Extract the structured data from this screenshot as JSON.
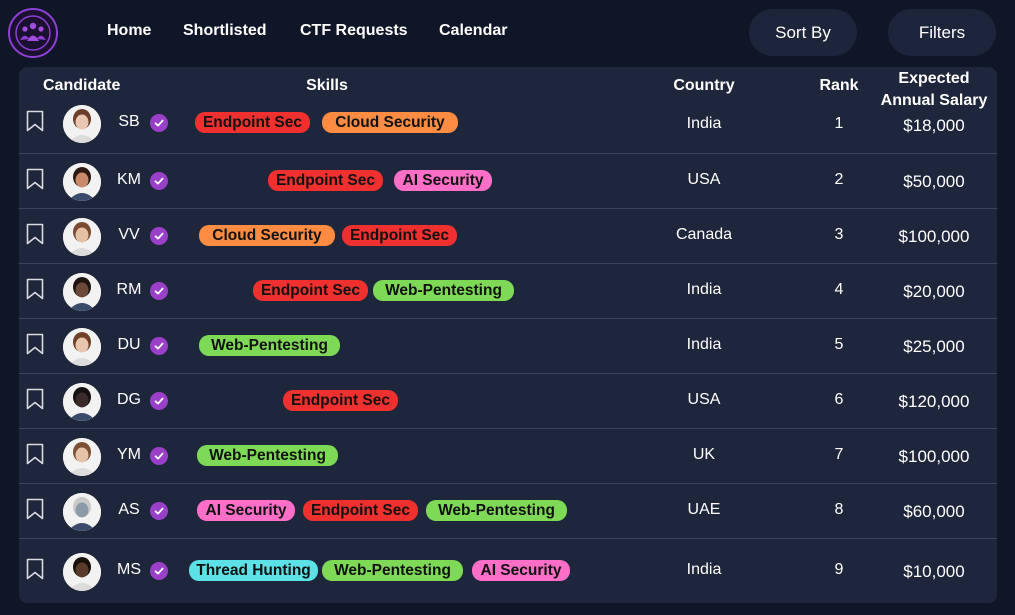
{
  "nav": {
    "home": "Home",
    "shortlisted": "Shortlisted",
    "ctf_requests": "CTF Requests",
    "calendar": "Calendar"
  },
  "actions": {
    "sort_by": "Sort By",
    "filters": "Filters"
  },
  "table": {
    "headers": {
      "candidate": "Candidate",
      "skills": "Skills",
      "country": "Country",
      "rank": "Rank",
      "salary_line1": "Expected",
      "salary_line2": "Annual Salary"
    },
    "rows": [
      {
        "initials": "SB",
        "skills": [
          "Endpoint Sec",
          "Cloud Security"
        ],
        "country": "India",
        "rank": "1",
        "salary": "$18,000"
      },
      {
        "initials": "KM",
        "skills": [
          "Endpoint Sec",
          "AI Security"
        ],
        "country": "USA",
        "rank": "2",
        "salary": "$50,000"
      },
      {
        "initials": "VV",
        "skills": [
          "Cloud Security",
          "Endpoint Sec"
        ],
        "country": "Canada",
        "rank": "3",
        "salary": "$100,000"
      },
      {
        "initials": "RM",
        "skills": [
          "Endpoint Sec",
          "Web-Pentesting"
        ],
        "country": "India",
        "rank": "4",
        "salary": "$20,000"
      },
      {
        "initials": "DU",
        "skills": [
          "Web-Pentesting"
        ],
        "country": "India",
        "rank": "5",
        "salary": "$25,000"
      },
      {
        "initials": "DG",
        "skills": [
          "Endpoint Sec"
        ],
        "country": "USA",
        "rank": "6",
        "salary": "$120,000"
      },
      {
        "initials": "YM",
        "skills": [
          "Web-Pentesting"
        ],
        "country": "UK",
        "rank": "7",
        "salary": "$100,000"
      },
      {
        "initials": "AS",
        "skills": [
          "AI Security",
          "Endpoint Sec",
          "Web-Pentesting"
        ],
        "country": "UAE",
        "rank": "8",
        "salary": "$60,000"
      },
      {
        "initials": "MS",
        "skills": [
          "Thread Hunting",
          "Web-Pentesting",
          "AI Security"
        ],
        "country": "India",
        "rank": "9",
        "salary": "$10,000"
      }
    ]
  },
  "colors": {
    "background": "#0f1628",
    "table_bg": "#1d263a",
    "accent_purple": "#9a3fc8",
    "tag_endpoint_sec": "#f0302f",
    "tag_cloud_security": "#ff8c42",
    "tag_ai_security": "#ff6ec7",
    "tag_web_pentesting": "#7ed957",
    "tag_thread_hunting": "#5ce1e6"
  },
  "icons": {
    "logo": "people-network-logo",
    "bookmark": "bookmark-icon",
    "verified": "verified-check-icon"
  }
}
